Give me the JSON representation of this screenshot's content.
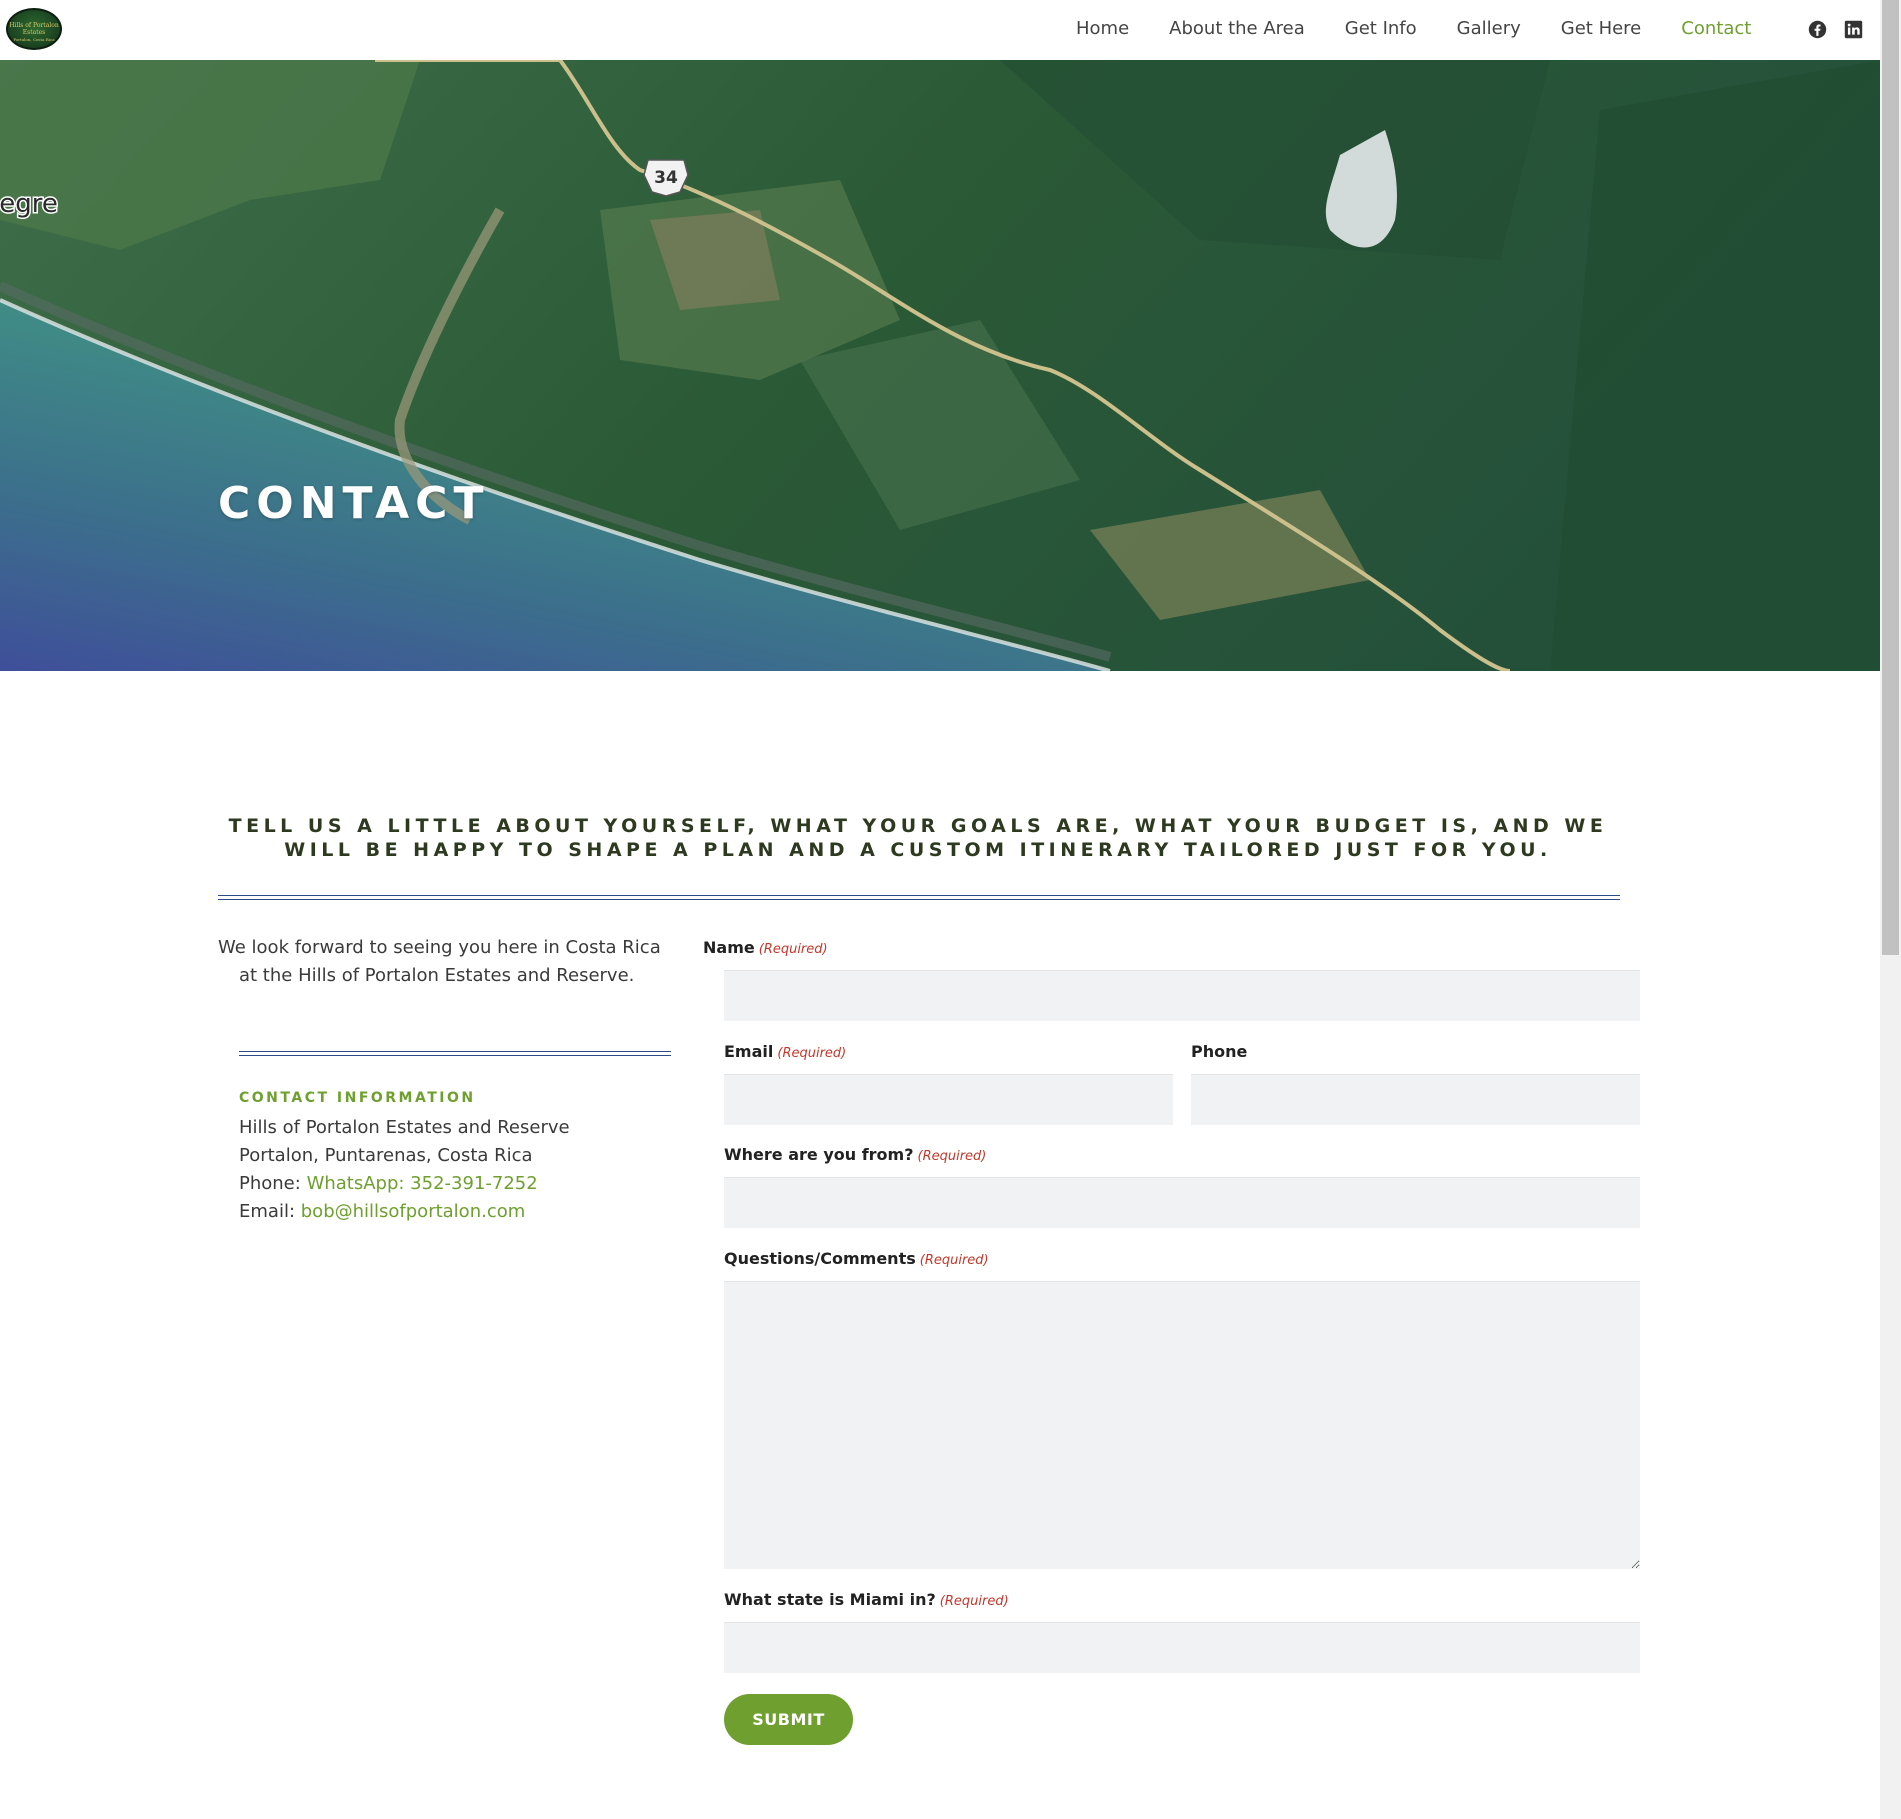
{
  "header": {
    "logo": {
      "line1": "Hills of Portalon",
      "line2": "Estates",
      "line3": "Portalon, Costa Rica"
    },
    "nav": [
      {
        "label": "Home"
      },
      {
        "label": "About the Area"
      },
      {
        "label": "Get Info"
      },
      {
        "label": "Gallery"
      },
      {
        "label": "Get Here"
      },
      {
        "label": "Contact",
        "active": true
      }
    ],
    "social": [
      {
        "icon": "facebook-icon"
      },
      {
        "icon": "linkedin-icon"
      }
    ]
  },
  "hero": {
    "title": "CONTACT",
    "map_labels": {
      "place": "legre",
      "route": "34"
    }
  },
  "tagline": "Tell us a little about yourself, what your goals are, what your budget is, and we will be happy to shape a plan and a custom itinerary tailored just for you.",
  "intro": "We look forward to seeing you here in Costa Rica at the Hills of Portalon Estates and Reserve.",
  "contact": {
    "heading": "Contact Information",
    "org": "Hills of Portalon Estates and Reserve",
    "address": "Portalon, Puntarenas, Costa Rica",
    "phone_label": "Phone:",
    "phone": "WhatsApp: 352-391-7252",
    "email_label": "Email:",
    "email": "bob@hillsofportalon.com"
  },
  "form": {
    "required_text": "(Required)",
    "fields": {
      "name": {
        "label": "Name",
        "value": ""
      },
      "email": {
        "label": "Email",
        "value": ""
      },
      "phone": {
        "label": "Phone",
        "value": ""
      },
      "from": {
        "label": "Where are you from?",
        "value": ""
      },
      "comments": {
        "label": "Questions/Comments",
        "value": ""
      },
      "captcha": {
        "label": "What state is Miami in?",
        "value": ""
      }
    },
    "submit_label": "SUBMIT"
  },
  "colors": {
    "accent": "#6e9f2f",
    "divider": "#2a4a8a",
    "heading_dark": "#2e3a1f",
    "required": "#c0392b",
    "field_bg": "#f1f2f3"
  }
}
